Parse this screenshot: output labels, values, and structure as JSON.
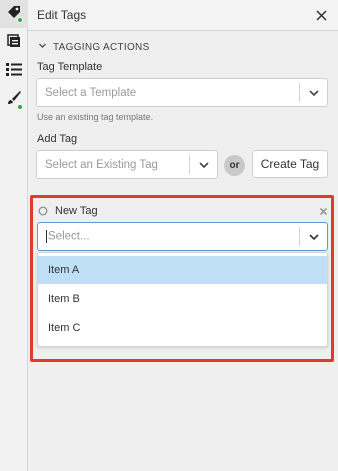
{
  "rail": {
    "items": [
      {
        "name": "tags",
        "icon": "tag-icon",
        "active": true,
        "badge": true
      },
      {
        "name": "layers",
        "icon": "cards-icon",
        "active": false,
        "badge": false
      },
      {
        "name": "list",
        "icon": "list-icon",
        "active": false,
        "badge": false
      },
      {
        "name": "brush",
        "icon": "paintbrush-icon",
        "active": false,
        "badge": true
      }
    ]
  },
  "header": {
    "title": "Edit Tags",
    "close_icon": "close-icon"
  },
  "section": {
    "title": "TAGGING ACTIONS",
    "chevron_icon": "chevron-down-icon"
  },
  "template": {
    "label": "Tag Template",
    "placeholder": "Select a Template",
    "help": "Use an existing tag template."
  },
  "add_tag": {
    "label": "Add Tag",
    "placeholder": "Select an Existing Tag",
    "or_label": "or",
    "create_label": "Create Tag"
  },
  "new_tag": {
    "title": "New Tag",
    "placeholder": "Select...",
    "options": [
      {
        "label": "Item A",
        "highlighted": true
      },
      {
        "label": "Item B",
        "highlighted": false
      },
      {
        "label": "Item C",
        "highlighted": false
      }
    ]
  },
  "colors": {
    "accent_green": "#2fa84f",
    "highlight_red": "#e03a2b",
    "option_hover": "#bfdff7",
    "focus_blue": "#5a9bd8"
  }
}
